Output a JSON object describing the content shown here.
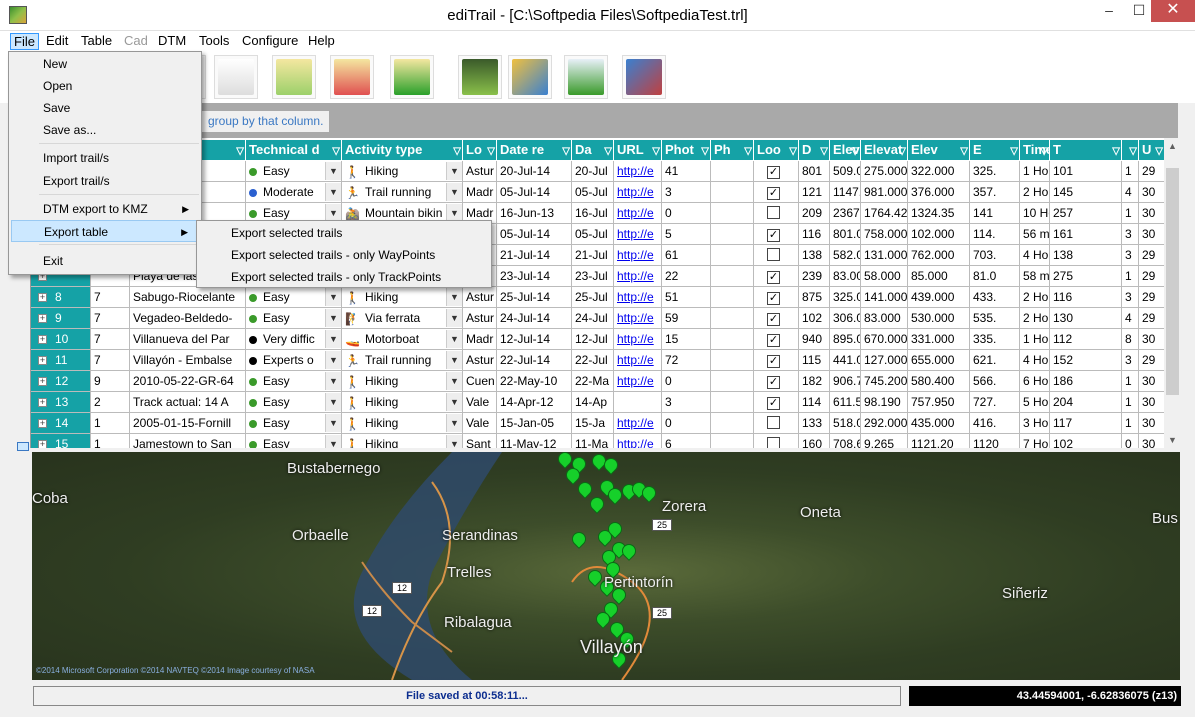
{
  "window": {
    "title": "ediTrail - [C:\\Softpedia Files\\SoftpediaTest.trl]",
    "minimize": "–",
    "maximize": "☐",
    "close": "✕"
  },
  "menubar": [
    {
      "label": "File",
      "disabled": false
    },
    {
      "label": "Edit",
      "disabled": false
    },
    {
      "label": "Table",
      "disabled": false
    },
    {
      "label": "Cad",
      "disabled": true
    },
    {
      "label": "DTM",
      "disabled": false
    },
    {
      "label": "Tools",
      "disabled": false
    },
    {
      "label": "Configure",
      "disabled": false
    },
    {
      "label": "Help",
      "disabled": false
    }
  ],
  "toolbar": [
    "globe-icon",
    "table-edit-icon",
    "table-waypoint-icon",
    "table-add-icon",
    "table-marker-icon",
    "camera-trail-icon",
    "photos-icon",
    "profile-chart-icon",
    "3d-terrain-icon"
  ],
  "group_hint": "group by that column.",
  "file_menu": {
    "items": [
      "New",
      "Open",
      "Save",
      "Save as...",
      "Import trail/s",
      "Export trail/s",
      "DTM export to KMZ",
      "Export table",
      "Exit"
    ],
    "submenu_arrow": "▶"
  },
  "export_submenu": [
    "Export selected trails",
    "Export selected trails - only WayPoints",
    "Export selected trails - only TrackPoints"
  ],
  "grid": {
    "columns": [
      "",
      "",
      "",
      "Technical d",
      "Activity type",
      "Lo",
      "Date re",
      "Da",
      "URL",
      "Phot",
      "Ph",
      "Loo",
      "D",
      "Elev",
      "Elevat",
      "Elev",
      "E",
      "Time",
      "T",
      "",
      "U"
    ],
    "filter_glyph": "▽",
    "dropdown_glyph": "▼",
    "check_glyph": "✓",
    "expander": "+",
    "rows": [
      {
        "id": "",
        "n": "",
        "name": "eguad",
        "diff": "Easy",
        "diffc": "#3a9a2a",
        "act": "Hiking",
        "acti": "🚶",
        "loc": "Astur",
        "date": "20-Jul-14",
        "da": "20-Jul",
        "url": "http://e",
        "phot": "41",
        "ph": "",
        "loo": true,
        "d": "801",
        "e1": "509.00",
        "e2": "275.000",
        "e3": "322.000",
        "e4": "325.",
        "time": "1 Hours 58",
        "t": "101",
        "x": "1",
        "u": "29"
      },
      {
        "id": "",
        "n": "",
        "name": "",
        "diff": "Moderate",
        "diffc": "#2a60d0",
        "act": "Trail running",
        "acti": "🏃",
        "loc": "Madr",
        "date": "05-Jul-14",
        "da": "05-Jul",
        "url": "http://e",
        "phot": "3",
        "ph": "",
        "loo": true,
        "d": "121",
        "e1": "1147.0",
        "e2": "981.000",
        "e3": "376.000",
        "e4": "357.",
        "time": "2 Hours 32",
        "t": "145",
        "x": "4",
        "u": "30"
      },
      {
        "id": "",
        "n": "",
        "name": "del",
        "diff": "Easy",
        "diffc": "#3a9a2a",
        "act": "Mountain bikin",
        "acti": "🚵",
        "loc": "Madr",
        "date": "16-Jun-13",
        "da": "16-Jul",
        "url": "http://e",
        "phot": "0",
        "ph": "",
        "loo": false,
        "d": "209",
        "e1": "2367.3",
        "e2": "1764.420",
        "e3": "1324.35",
        "e4": "141",
        "time": "10 Hours 56",
        "t": "257",
        "x": "1",
        "u": "30"
      },
      {
        "id": "",
        "n": "",
        "name": "",
        "diff": "",
        "diffc": "",
        "act": "",
        "acti": "",
        "loc": "",
        "date": "05-Jul-14",
        "da": "05-Jul",
        "url": "http://e",
        "phot": "5",
        "ph": "",
        "loo": true,
        "d": "116",
        "e1": "801.00",
        "e2": "758.000",
        "e3": "102.000",
        "e4": "114.",
        "time": "56 minutes",
        "t": "161",
        "x": "3",
        "u": "30"
      },
      {
        "id": "",
        "n": "",
        "name": "",
        "diff": "",
        "diffc": "",
        "act": "",
        "acti": "",
        "loc": "",
        "date": "21-Jul-14",
        "da": "21-Jul",
        "url": "http://e",
        "phot": "61",
        "ph": "",
        "loo": false,
        "d": "138",
        "e1": "582.00",
        "e2": "131.000",
        "e3": "762.000",
        "e4": "703.",
        "time": "4 Hours 59",
        "t": "138",
        "x": "3",
        "u": "29"
      },
      {
        "id": "",
        "n": "",
        "name": "Playa de las",
        "diff": "",
        "diffc": "",
        "act": "",
        "acti": "",
        "loc": "",
        "date": "23-Jul-14",
        "da": "23-Jul",
        "url": "http://e",
        "phot": "22",
        "ph": "",
        "loo": true,
        "d": "239",
        "e1": "83.000",
        "e2": "58.000",
        "e3": "85.000",
        "e4": "81.0",
        "time": "58 minutes",
        "t": "275",
        "x": "1",
        "u": "29"
      },
      {
        "id": "8",
        "n": "7",
        "name": "Sabugo-Riocelante",
        "diff": "Easy",
        "diffc": "#3a9a2a",
        "act": "Hiking",
        "acti": "🚶",
        "loc": "Astur",
        "date": "25-Jul-14",
        "da": "25-Jul",
        "url": "http://e",
        "phot": "51",
        "ph": "",
        "loo": true,
        "d": "875",
        "e1": "325.00",
        "e2": "141.000",
        "e3": "439.000",
        "e4": "433.",
        "time": "2 Hours 49",
        "t": "116",
        "x": "3",
        "u": "29"
      },
      {
        "id": "9",
        "n": "7",
        "name": "Vegadeo-Beldedo-",
        "diff": "Easy",
        "diffc": "#3a9a2a",
        "act": "Via ferrata",
        "acti": "🧗",
        "loc": "Astur",
        "date": "24-Jul-14",
        "da": "24-Jul",
        "url": "http://e",
        "phot": "59",
        "ph": "",
        "loo": true,
        "d": "102",
        "e1": "306.00",
        "e2": "83.000",
        "e3": "530.000",
        "e4": "535.",
        "time": "2 Hours 48",
        "t": "130",
        "x": "4",
        "u": "29"
      },
      {
        "id": "10",
        "n": "7",
        "name": "Villanueva del Par",
        "diff": "Very diffic",
        "diffc": "#000",
        "act": "Motorboat",
        "acti": "🚤",
        "loc": "Madr",
        "date": "12-Jul-14",
        "da": "12-Jul",
        "url": "http://e",
        "phot": "15",
        "ph": "",
        "loo": true,
        "d": "940",
        "e1": "895.00",
        "e2": "670.000",
        "e3": "331.000",
        "e4": "335.",
        "time": "1 Hours 9 m",
        "t": "112",
        "x": "8",
        "u": "30"
      },
      {
        "id": "11",
        "n": "7",
        "name": "Villayón - Embalse",
        "diff": "Experts o",
        "diffc": "#000",
        "act": "Trail running",
        "acti": "🏃",
        "loc": "Astur",
        "date": "22-Jul-14",
        "da": "22-Jul",
        "url": "http://e",
        "phot": "72",
        "ph": "",
        "loo": true,
        "d": "115",
        "e1": "441.00",
        "e2": "127.000",
        "e3": "655.000",
        "e4": "621.",
        "time": "4 Hours 43",
        "t": "152",
        "x": "3",
        "u": "29"
      },
      {
        "id": "12",
        "n": "9",
        "name": "2010-05-22-GR-64",
        "diff": "Easy",
        "diffc": "#3a9a2a",
        "act": "Hiking",
        "acti": "🚶",
        "loc": "Cuen",
        "date": "22-May-10",
        "da": "22-Ma",
        "url": "http://e",
        "phot": "0",
        "ph": "",
        "loo": true,
        "d": "182",
        "e1": "906.70",
        "e2": "745.200",
        "e3": "580.400",
        "e4": "566.",
        "time": "6 Hours 3 m",
        "t": "186",
        "x": "1",
        "u": "30"
      },
      {
        "id": "13",
        "n": "2",
        "name": "Track actual: 14 A",
        "diff": "Easy",
        "diffc": "#3a9a2a",
        "act": "Hiking",
        "acti": "🚶",
        "loc": "Vale",
        "date": "14-Apr-12",
        "da": "14-Ap",
        "url": "",
        "phot": "3",
        "ph": "",
        "loo": true,
        "d": "114",
        "e1": "611.54",
        "e2": "98.190",
        "e3": "757.950",
        "e4": "727.",
        "time": "5 Hours 36",
        "t": "204",
        "x": "1",
        "u": "30"
      },
      {
        "id": "14",
        "n": "1",
        "name": "2005-01-15-Fornill",
        "diff": "Easy",
        "diffc": "#3a9a2a",
        "act": "Hiking",
        "acti": "🚶",
        "loc": "Vale",
        "date": "15-Jan-05",
        "da": "15-Ja",
        "url": "http://e",
        "phot": "0",
        "ph": "",
        "loo": false,
        "d": "133",
        "e1": "518.00",
        "e2": "292.000",
        "e3": "435.000",
        "e4": "416.",
        "time": "3 Hours 45",
        "t": "117",
        "x": "1",
        "u": "30"
      },
      {
        "id": "15",
        "n": "1",
        "name": "Jamestown to San",
        "diff": "Easy",
        "diffc": "#3a9a2a",
        "act": "Hiking",
        "acti": "🚶",
        "loc": "Sant",
        "date": "11-May-12",
        "da": "11-Ma",
        "url": "http://e",
        "phot": "6",
        "ph": "",
        "loo": false,
        "d": "160",
        "e1": "708.65",
        "e2": "9.265",
        "e3": "1121.20",
        "e4": "1120",
        "time": "7 Hours 10",
        "t": "102",
        "x": "0",
        "u": "30"
      }
    ]
  },
  "map": {
    "places": [
      {
        "name": "Bustabernego"
      },
      {
        "name": "Coba"
      },
      {
        "name": "Orbaelle"
      },
      {
        "name": "Serandinas"
      },
      {
        "name": "Trelles"
      },
      {
        "name": "Ribalagua"
      },
      {
        "name": "Zorera"
      },
      {
        "name": "Oneta"
      },
      {
        "name": "Bus"
      },
      {
        "name": "Pertintorín"
      },
      {
        "name": "Siñeriz"
      },
      {
        "name": "Villayón"
      }
    ],
    "roads": [
      "12",
      "12",
      "25",
      "25"
    ],
    "copyright": "©2014 Microsoft Corporation ©2014 NAVTEQ ©2014 Image courtesy of NASA"
  },
  "status": {
    "message": "File saved at 00:58:11...",
    "coords": "43.44594001, -6.62836075 (z13)"
  },
  "colors": {
    "header": "#15a2a6",
    "accent": "#3399ff",
    "close": "#c75050"
  }
}
